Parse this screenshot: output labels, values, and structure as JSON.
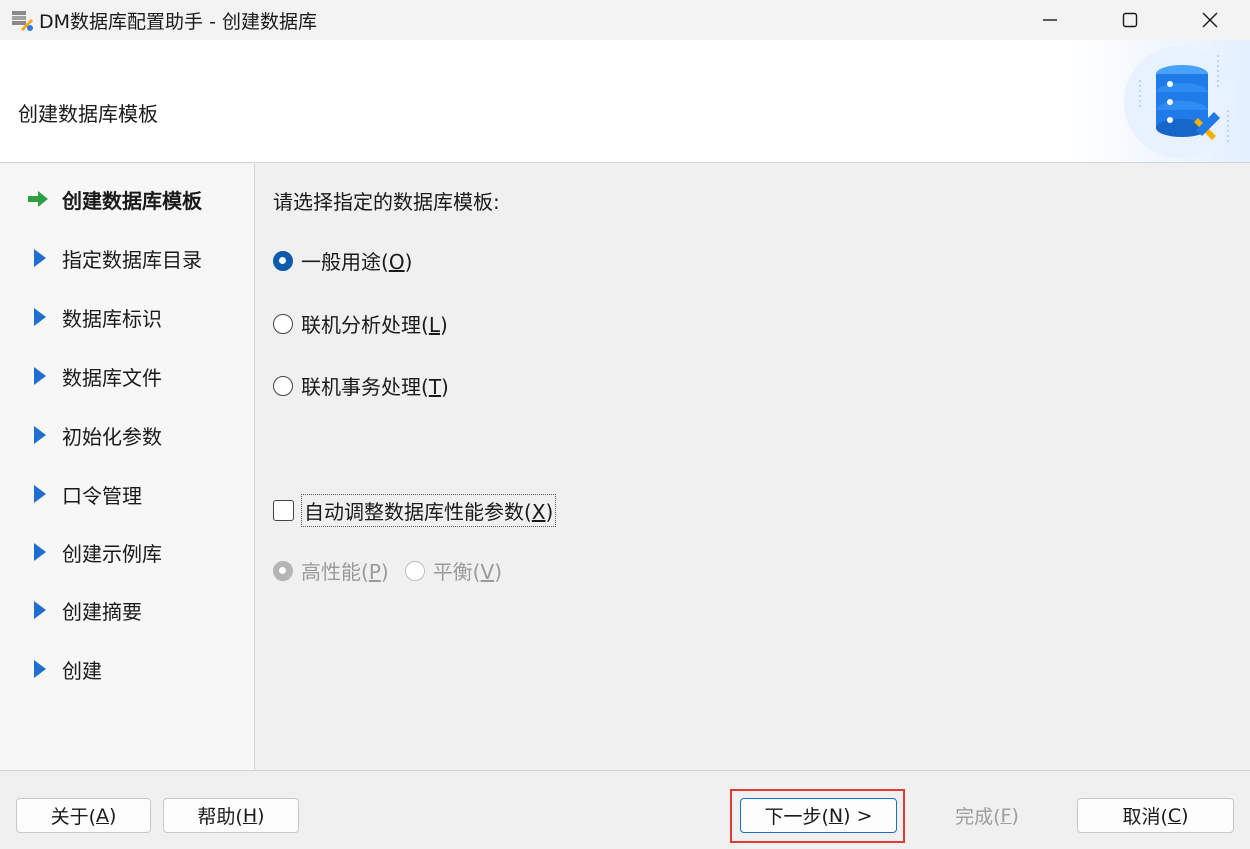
{
  "window": {
    "title": "DM数据库配置助手 - 创建数据库",
    "minimize_icon": "minimize-icon",
    "maximize_icon": "maximize-icon",
    "close_icon": "close-icon"
  },
  "header": {
    "title": "创建数据库模板",
    "art_icon": "database-tools-icon"
  },
  "nav": {
    "items": [
      {
        "label": "创建数据库模板",
        "active": true
      },
      {
        "label": "指定数据库目录",
        "active": false
      },
      {
        "label": "数据库标识",
        "active": false
      },
      {
        "label": "数据库文件",
        "active": false
      },
      {
        "label": "初始化参数",
        "active": false
      },
      {
        "label": "口令管理",
        "active": false
      },
      {
        "label": "创建示例库",
        "active": false
      },
      {
        "label": "创建摘要",
        "active": false
      },
      {
        "label": "创建",
        "active": false
      }
    ],
    "active_color": "#2ea043",
    "pending_color": "#1f6fd1"
  },
  "main": {
    "prompt": "请选择指定的数据库模板:",
    "templates": [
      {
        "label": "一般用途(",
        "key": "O",
        "suffix": ")",
        "checked": true
      },
      {
        "label": "联机分析处理(",
        "key": "L",
        "suffix": ")",
        "checked": false
      },
      {
        "label": "联机事务处理(",
        "key": "T",
        "suffix": ")",
        "checked": false
      }
    ],
    "auto_tune": {
      "label": "自动调整数据库性能参数(",
      "key": "X",
      "suffix": ")",
      "checked": false
    },
    "perf_options": [
      {
        "label": "高性能(",
        "key": "P",
        "suffix": ")",
        "checked": true,
        "disabled": true
      },
      {
        "label": "平衡(",
        "key": "V",
        "suffix": ")",
        "checked": false,
        "disabled": true
      }
    ]
  },
  "footer": {
    "about": {
      "label": "关于(",
      "key": "A",
      "suffix": ")"
    },
    "help": {
      "label": "帮助(",
      "key": "H",
      "suffix": ")"
    },
    "next": {
      "label": "下一步(",
      "key": "N",
      "suffix": ") >"
    },
    "finish": {
      "label": "完成(",
      "key": "F",
      "suffix": ")"
    },
    "cancel": {
      "label": "取消(",
      "key": "C",
      "suffix": ")"
    },
    "highlight_color": "#e53935"
  }
}
